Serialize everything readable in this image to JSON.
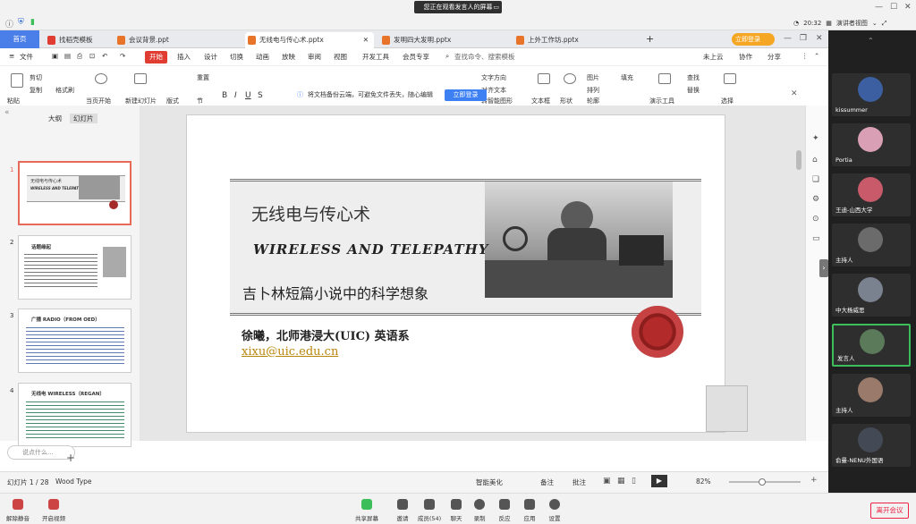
{
  "meeting": {
    "share_banner": "您正在观看发言人的屏幕",
    "time": "20:32",
    "view_label": "演讲者视图"
  },
  "tabs": [
    {
      "label": "首页"
    },
    {
      "label": "找稻壳模板"
    },
    {
      "label": "会议背景.ppt"
    },
    {
      "label": "无线电与传心术.pptx"
    },
    {
      "label": "发明四大发明.pptx"
    },
    {
      "label": "上外工作坊.pptx"
    }
  ],
  "login_label": "立即登录",
  "menu": [
    "文件",
    "开始",
    "插入",
    "设计",
    "切换",
    "动画",
    "放映",
    "审阅",
    "视图",
    "开发工具",
    "会员专享"
  ],
  "search_placeholder": "查找命令、搜索模板",
  "cloud_label": "未上云",
  "collab_label": "协作",
  "share_label": "分享",
  "ribbon": {
    "paste": "粘贴",
    "cut": "剪切",
    "copy": "复制",
    "format_painter": "格式刷",
    "from_current": "当页开始",
    "new_slide": "新建幻灯片",
    "layout": "版式",
    "section": "节",
    "reset": "重置",
    "textbox": "文本框",
    "shape": "形状",
    "arrange": "排列",
    "picture": "图片",
    "fill": "填充",
    "outline": "轮廓",
    "present_tools": "演示工具",
    "find": "查找",
    "replace": "替换",
    "select": "选择",
    "text_direction": "文字方向",
    "align_text": "对齐文本",
    "smartart": "转智能图形"
  },
  "notice": {
    "text": "将文档备份云端，可避免文件丢失，随心编辑",
    "button": "立即登录"
  },
  "left_panel": {
    "tab_outline": "大纲",
    "tab_slides": "幻灯片",
    "thumbs": [
      {
        "num": "1",
        "title": "无线电与传心术",
        "sub": "WIRELESS AND TELEPATHY"
      },
      {
        "num": "2",
        "title": "话题缘起",
        "sub": ""
      },
      {
        "num": "3",
        "title": "广播 RADIO（FROM OED）",
        "sub": ""
      },
      {
        "num": "4",
        "title": "无线电 WIRELESS（REGAN）",
        "sub": ""
      }
    ],
    "chat_placeholder": "说点什么..."
  },
  "slide": {
    "title": "无线电与传心术",
    "english": "WIRELESS AND TELEPATHY",
    "subtitle": "吉卜林短篇小说中的科学想象",
    "author": "徐曦，北师港浸大(UIC) 英语系",
    "email": "xixu@uic.edu.cn"
  },
  "status": {
    "slide_pos": "幻灯片 1 / 28",
    "theme": "Wood Type",
    "smart_beautify": "智能美化",
    "notes": "备注",
    "comments": "批注",
    "zoom": "82%"
  },
  "participants": [
    {
      "name": "kissummer",
      "color": "#3b5fa0"
    },
    {
      "name": "Portia",
      "color": "#d9a0b5"
    },
    {
      "name": "王迪-山西大学",
      "color": "#c85a6a"
    },
    {
      "name": "主持人",
      "color": "#6b6b6b"
    },
    {
      "name": "中大杨威思",
      "color": "#7a8290"
    },
    {
      "name": "发言人",
      "color": "#5a7a5a"
    },
    {
      "name": "主持人",
      "color": "#9a7a6a"
    },
    {
      "name": "俞曼-NENU外国语",
      "color": "#444a55"
    }
  ],
  "bottom": {
    "mute": "解除静音",
    "video": "开启视频",
    "share": "共享屏幕",
    "invite": "邀请",
    "members": "成员(54)",
    "chat": "聊天",
    "record": "录制",
    "reactions": "反应",
    "apps": "应用",
    "settings": "设置",
    "leave": "离开会议"
  }
}
